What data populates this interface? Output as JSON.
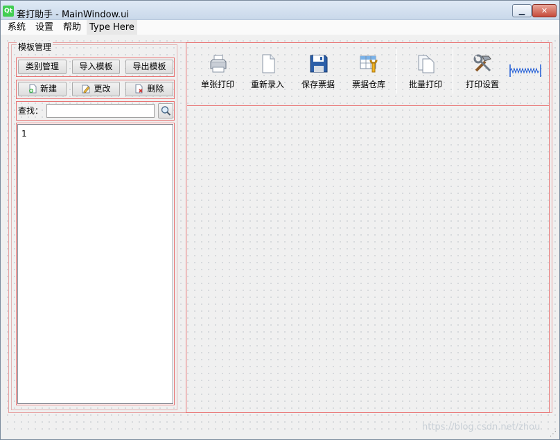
{
  "window": {
    "title": "套打助手 - MainWindow.ui",
    "logo_text": "Qt",
    "minimize_symbol": "▁",
    "close_symbol": "✕"
  },
  "menubar": {
    "items": [
      "系统",
      "设置",
      "帮助"
    ],
    "type_here": "Type Here"
  },
  "left_panel": {
    "group_title": "模板管理",
    "row1_buttons": [
      "类别管理",
      "导入模板",
      "导出模板"
    ],
    "row2_buttons": [
      {
        "label": "新建",
        "icon": "new-doc-icon"
      },
      {
        "label": "更改",
        "icon": "edit-icon"
      },
      {
        "label": "删除",
        "icon": "delete-doc-icon"
      }
    ],
    "search": {
      "label": "查找：",
      "value": "",
      "icon": "magnifier-icon"
    },
    "list": {
      "items": [
        "1"
      ]
    }
  },
  "toolbar": {
    "actions": [
      {
        "label": "单张打印",
        "icon": "printer-icon"
      },
      {
        "label": "重新录入",
        "icon": "blank-page-icon"
      },
      {
        "label": "保存票据",
        "icon": "floppy-disk-icon"
      },
      {
        "label": "票据仓库",
        "icon": "table-wrench-icon"
      },
      {
        "label": "批量打印",
        "icon": "copy-pages-icon"
      },
      {
        "label": "打印设置",
        "icon": "tools-icon"
      }
    ]
  },
  "watermark": "https://blog.csdn.net/zhou",
  "colors": {
    "layout_outline": "#e87474",
    "accent_blue": "#1e5bd6"
  }
}
